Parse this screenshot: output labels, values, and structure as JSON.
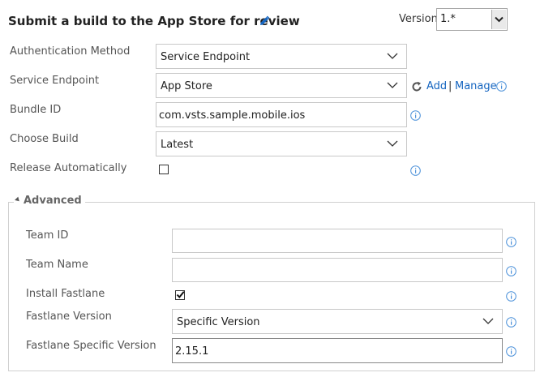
{
  "header": {
    "title": "Submit a build to the App Store for review",
    "version_label": "Version",
    "version_value": "1.*"
  },
  "form": {
    "auth_method": {
      "label": "Authentication Method",
      "value": "Service Endpoint"
    },
    "service_endpoint": {
      "label": "Service Endpoint",
      "value": "App Store",
      "add_link": "Add",
      "separator": "|",
      "manage_link": "Manage"
    },
    "bundle_id": {
      "label": "Bundle ID",
      "value": "com.vsts.sample.mobile.ios"
    },
    "choose_build": {
      "label": "Choose Build",
      "value": "Latest"
    },
    "release_auto": {
      "label": "Release Automatically",
      "checked": false
    }
  },
  "advanced": {
    "title": "Advanced",
    "team_id": {
      "label": "Team ID",
      "value": ""
    },
    "team_name": {
      "label": "Team Name",
      "value": ""
    },
    "install_fastlane": {
      "label": "Install Fastlane",
      "checked": true
    },
    "fastlane_version": {
      "label": "Fastlane Version",
      "value": "Specific Version"
    },
    "fastlane_specific_version": {
      "label": "Fastlane Specific Version",
      "value": "2.15.1"
    }
  },
  "icons": {
    "edit": "pencil-icon",
    "refresh": "refresh-icon",
    "info": "info-icon",
    "dropdown": "chevron-down-icon"
  },
  "colors": {
    "link": "#1565c0",
    "info": "#4a90d9"
  }
}
